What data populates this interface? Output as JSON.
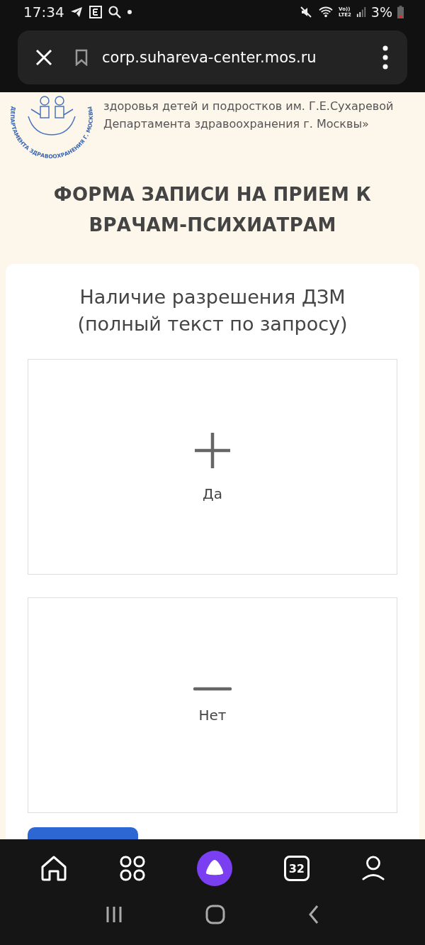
{
  "status_bar": {
    "time": "17:34",
    "volte": "Vo))",
    "network": "LTE2",
    "battery": "3%"
  },
  "browser": {
    "url": "corp.suhareva-center.mos.ru"
  },
  "header": {
    "logo_text": "ДЕПАРТАМЕНТА ЗДРАВООХРАНЕНИЯ Г. МОСКВЫ",
    "lines": [
      "здоровья детей и подростков им. Г.Е.Сухаревой",
      "Департамента здравоохранения г. Москвы»"
    ]
  },
  "title": "ФОРМА ЗАПИСИ НА ПРИЕМ К ВРАЧАМ-ПСИХИАТРАМ",
  "question": "Наличие разрешения ДЗМ (полный текст по запросу)",
  "options": [
    {
      "kind": "plus",
      "label": "Да",
      "selected": false
    },
    {
      "kind": "minus",
      "label": "Нет",
      "selected": false
    }
  ],
  "bottom_nav": {
    "tabs_count": "32"
  }
}
